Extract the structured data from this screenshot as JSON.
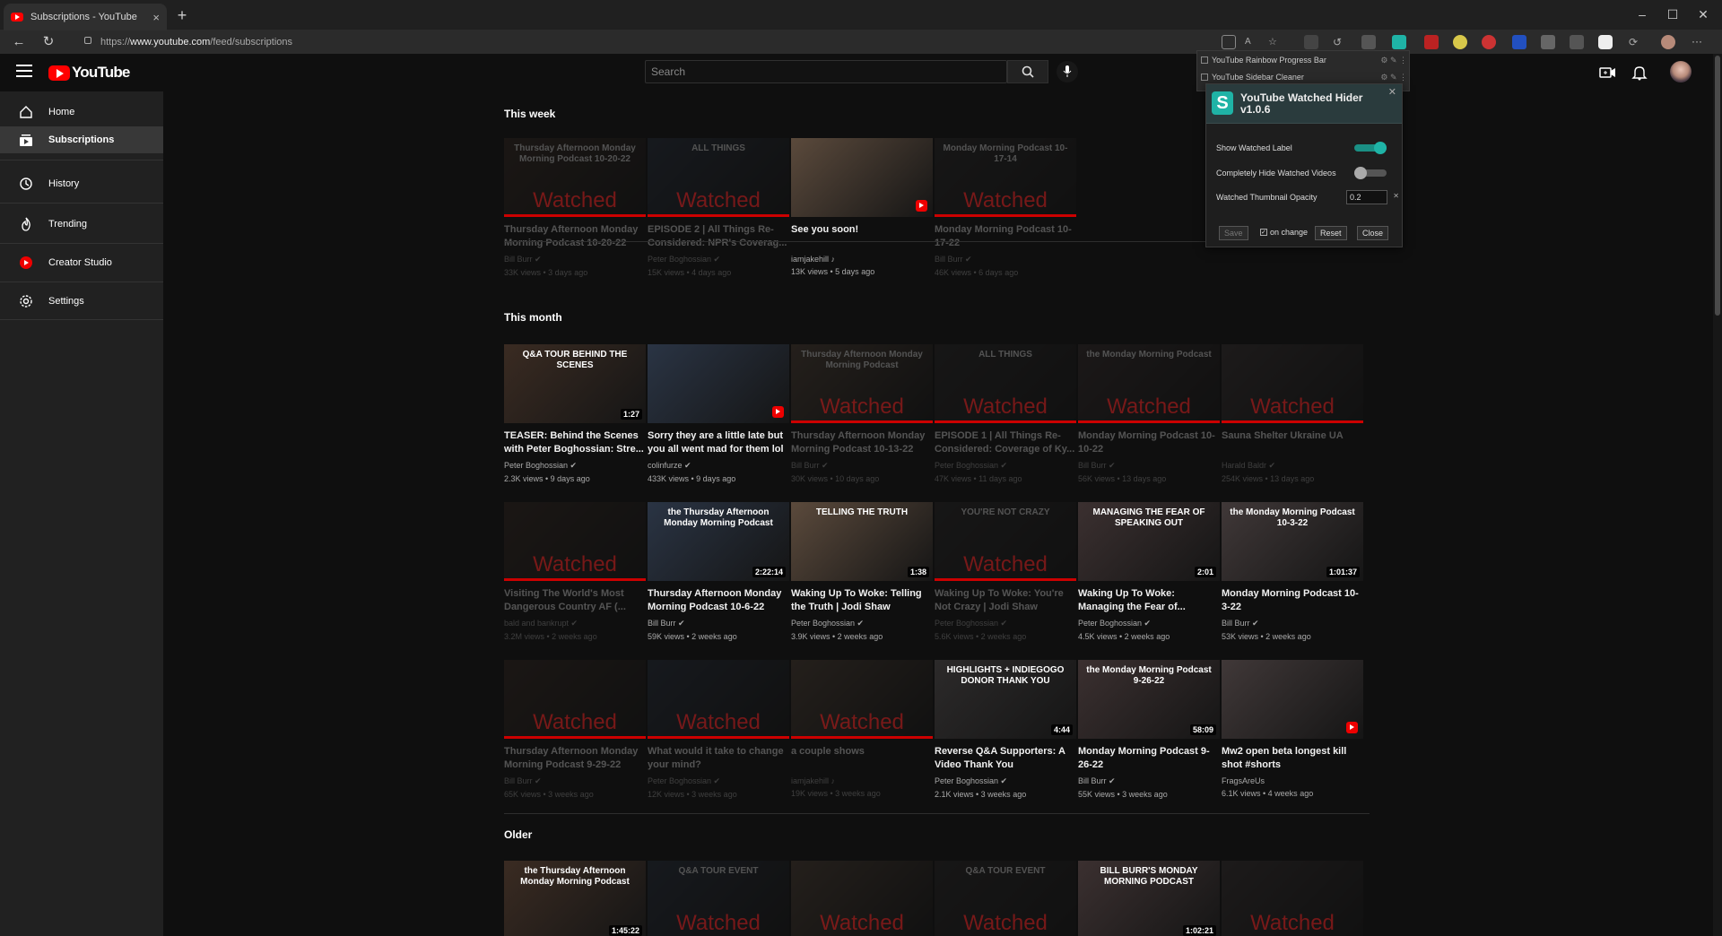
{
  "tab": {
    "title": "Subscriptions - YouTube",
    "close": "×",
    "new": "+"
  },
  "window": {
    "minimize": "–",
    "maximize": "☐",
    "close": "✕"
  },
  "address": {
    "prefix": "https://",
    "host": "www.youtube.com",
    "path": "/feed/subscriptions"
  },
  "search": {
    "placeholder": "Search"
  },
  "sidebar": {
    "items": [
      {
        "label": "Home",
        "icon": "home-icon"
      },
      {
        "label": "Subscriptions",
        "icon": "subscriptions-icon"
      },
      {
        "label": "History",
        "icon": "history-icon"
      },
      {
        "label": "Trending",
        "icon": "trending-icon"
      },
      {
        "label": "Creator Studio",
        "icon": "creator-studio-icon"
      },
      {
        "label": "Settings",
        "icon": "settings-icon"
      }
    ]
  },
  "sections": {
    "week": "This week",
    "month": "This month",
    "older": "Older"
  },
  "watched_label": "Watched",
  "ext_list": {
    "item1": "YouTube Rainbow Progress Bar",
    "item2": "YouTube Sidebar Cleaner",
    "tools": "⚙ ✎ ⋮"
  },
  "popup": {
    "title": "YouTube Watched Hider v1.0.6",
    "close": "✕",
    "show_label": "Show Watched Label",
    "hide_label": "Completely Hide Watched Videos",
    "opacity_label": "Watched Thumbnail Opacity",
    "opacity_value": "0.2",
    "clear": "✕",
    "save": "Save",
    "on_change": "on change",
    "reset": "Reset",
    "close_btn": "Close",
    "accent": "#1fb3a6"
  },
  "week_videos": [
    {
      "title": "Thursday Afternoon Monday Morning Podcast 10-20-22",
      "channel": "Bill Burr ✔",
      "meta": "33K views • 3 days ago",
      "watched": true,
      "thumb": "Thursday Afternoon Monday Morning Podcast 10-20-22"
    },
    {
      "title": "EPISODE 2 | All Things Re-Considered: NPR's Coverag...",
      "channel": "Peter Boghossian ✔",
      "meta": "15K views • 4 days ago",
      "watched": true,
      "thumb": "ALL THINGS"
    },
    {
      "title": "See you soon!",
      "channel": "iamjakehill ♪",
      "meta": "13K views • 5 days ago",
      "watched": false,
      "short": true,
      "thumb": ""
    },
    {
      "title": "Monday Morning Podcast 10-17-22",
      "channel": "Bill Burr ✔",
      "meta": "46K views • 6 days ago",
      "watched": true,
      "thumb": "Monday Morning Podcast 10-17-14"
    }
  ],
  "month_row1": [
    {
      "title": "TEASER: Behind the Scenes with Peter Boghossian: Stre...",
      "channel": "Peter Boghossian ✔",
      "meta": "2.3K views • 9 days ago",
      "watched": false,
      "dur": "1:27",
      "thumb": "Q&A TOUR BEHIND THE SCENES"
    },
    {
      "title": "Sorry they are a little late but you all went mad for them lol",
      "channel": "colinfurze ✔",
      "meta": "433K views • 9 days ago",
      "watched": false,
      "short": true,
      "thumb": ""
    },
    {
      "title": "Thursday Afternoon Monday Morning Podcast 10-13-22",
      "channel": "Bill Burr ✔",
      "meta": "30K views • 10 days ago",
      "watched": true,
      "thumb": "Thursday Afternoon Monday Morning Podcast"
    },
    {
      "title": "EPISODE 1 | All Things Re-Considered: Coverage of Ky...",
      "channel": "Peter Boghossian ✔",
      "meta": "47K views • 11 days ago",
      "watched": true,
      "thumb": "ALL THINGS"
    },
    {
      "title": "Monday Morning Podcast 10-10-22",
      "channel": "Bill Burr ✔",
      "meta": "56K views • 13 days ago",
      "watched": true,
      "thumb": "the Monday Morning Podcast"
    },
    {
      "title": "Sauna Shelter Ukraine UA",
      "channel": "Harald Baldr ✔",
      "meta": "254K views • 13 days ago",
      "watched": true,
      "thumb": ""
    }
  ],
  "month_row2": [
    {
      "title": "Visiting The World's Most Dangerous Country AF (...",
      "channel": "bald and bankrupt ✔",
      "meta": "3.2M views • 2 weeks ago",
      "watched": true,
      "thumb": ""
    },
    {
      "title": "Thursday Afternoon Monday Morning Podcast 10-6-22",
      "channel": "Bill Burr ✔",
      "meta": "59K views • 2 weeks ago",
      "watched": false,
      "dur": "2:22:14",
      "thumb": "the Thursday Afternoon Monday Morning Podcast"
    },
    {
      "title": "Waking Up To Woke: Telling the Truth | Jodi Shaw",
      "channel": "Peter Boghossian ✔",
      "meta": "3.9K views • 2 weeks ago",
      "watched": false,
      "dur": "1:38",
      "thumb": "TELLING THE TRUTH"
    },
    {
      "title": "Waking Up To Woke: You're Not Crazy | Jodi Shaw",
      "channel": "Peter Boghossian ✔",
      "meta": "5.6K views • 2 weeks ago",
      "watched": true,
      "thumb": "YOU'RE NOT CRAZY"
    },
    {
      "title": "Waking Up To Woke: Managing the Fear of...",
      "channel": "Peter Boghossian ✔",
      "meta": "4.5K views • 2 weeks ago",
      "watched": false,
      "dur": "2:01",
      "thumb": "MANAGING THE FEAR OF SPEAKING OUT"
    },
    {
      "title": "Monday Morning Podcast 10-3-22",
      "channel": "Bill Burr ✔",
      "meta": "53K views • 2 weeks ago",
      "watched": false,
      "dur": "1:01:37",
      "thumb": "the Monday Morning Podcast 10-3-22"
    }
  ],
  "month_row3": [
    {
      "title": "Thursday Afternoon Monday Morning Podcast 9-29-22",
      "channel": "Bill Burr ✔",
      "meta": "65K views • 3 weeks ago",
      "watched": true,
      "thumb": ""
    },
    {
      "title": "What would it take to change your mind?",
      "channel": "Peter Boghossian ✔",
      "meta": "12K views • 3 weeks ago",
      "watched": true,
      "thumb": ""
    },
    {
      "title": "a couple shows",
      "channel": "iamjakehill ♪",
      "meta": "19K views • 3 weeks ago",
      "watched": true,
      "thumb": ""
    },
    {
      "title": "Reverse Q&A Supporters: A Video Thank You",
      "channel": "Peter Boghossian ✔",
      "meta": "2.1K views • 3 weeks ago",
      "watched": false,
      "dur": "4:44",
      "thumb": "HIGHLIGHTS + INDIEGOGO DONOR THANK YOU"
    },
    {
      "title": "Monday Morning Podcast 9-26-22",
      "channel": "Bill Burr ✔",
      "meta": "55K views • 3 weeks ago",
      "watched": false,
      "dur": "58:09",
      "thumb": "the Monday Morning Podcast 9-26-22"
    },
    {
      "title": "Mw2 open beta longest kill shot #shorts",
      "channel": "FragsAreUs",
      "meta": "6.1K views • 4 weeks ago",
      "watched": false,
      "short": true,
      "thumb": ""
    }
  ],
  "older_row": [
    {
      "watched": false,
      "dur": "1:45:22",
      "thumb": "the Thursday Afternoon Monday Morning Podcast"
    },
    {
      "watched": true,
      "thumb": "Q&A TOUR EVENT"
    },
    {
      "watched": true,
      "thumb": ""
    },
    {
      "watched": true,
      "thumb": "Q&A TOUR EVENT"
    },
    {
      "watched": false,
      "dur": "1:02:21",
      "thumb": "BILL BURR'S MONDAY MORNING PODCAST"
    },
    {
      "watched": true,
      "thumb": ""
    }
  ]
}
